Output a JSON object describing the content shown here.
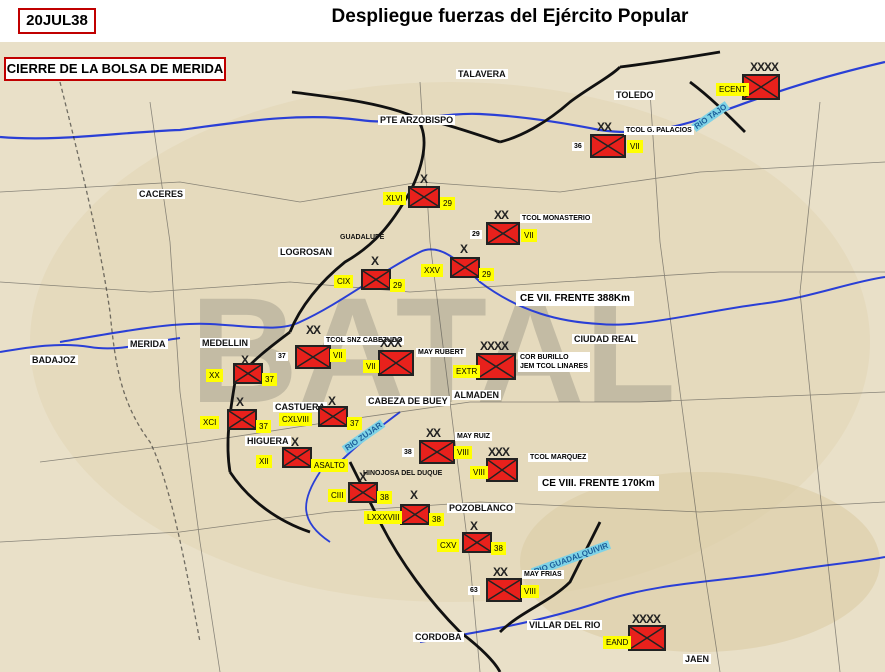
{
  "header": {
    "date": "20JUL38",
    "title": "Despliegue fuerzas del Ejército Popular"
  },
  "panel": {
    "label": "CIERRE DE LA BOLSA DE MERIDA"
  },
  "colors": {
    "unit_fill": "#e8211c",
    "label_bg": "#ffff00",
    "river": "#2a3fd6",
    "front_line": "#111111",
    "map_bg": "#e9e0c8"
  },
  "places": {
    "pte_arzobispo": "PTE ARZOBISPO",
    "toledo": "TOLEDO",
    "talavera": "TALAVERA",
    "caceres": "CACERES",
    "logrosan": "LOGROSAN",
    "guadalupe": "GUADALUPE",
    "merida": "MERIDA",
    "medellin": "MEDELLIN",
    "badajoz": "BADAJOZ",
    "castuera": "CASTUERA",
    "higuera": "HIGUERA",
    "cabeza_de_buey": "CABEZA DE BUEY",
    "almaden": "ALMADEN",
    "ciudad_real": "CIUDAD REAL",
    "pozoblanco": "POZOBLANCO",
    "hinojosa": "HINOJOSA DEL DUQUE",
    "cordoba": "CORDOBA",
    "villar_del_rio": "VILLAR DEL RIO",
    "jaen": "JAEN",
    "rio_tajo": "RIO TAJO",
    "rio_zujar": "RIO ZUJAR",
    "rio_guadalquivir": "RIO GUADALQUIVIR"
  },
  "fronts": {
    "ce_vii": "CE VII. FRENTE 388Km",
    "ce_viii": "CE VIII. FRENTE 170Km"
  },
  "units": [
    {
      "id": "ecent",
      "echelon": "XXXX",
      "labels": [
        "ECENT"
      ]
    },
    {
      "id": "vii-palacios",
      "echelon": "XX",
      "labels": [
        "36",
        "VII"
      ],
      "note": "TCOL G. PALACIOS"
    },
    {
      "id": "xlvi",
      "echelon": "X",
      "labels": [
        "XLVI",
        "29"
      ]
    },
    {
      "id": "vii-monasterio",
      "echelon": "XX",
      "labels": [
        "29",
        "VII"
      ],
      "note": "TCOL MONASTERIO"
    },
    {
      "id": "xxv",
      "echelon": "X",
      "labels": [
        "XXV",
        "29"
      ]
    },
    {
      "id": "cix",
      "echelon": "X",
      "labels": [
        "CIX",
        "29"
      ]
    },
    {
      "id": "vii-cabezudo",
      "echelon": "XX",
      "labels": [
        "37",
        "VII"
      ],
      "note": "TCOL SNZ CABEZUDO"
    },
    {
      "id": "vii-rubert",
      "echelon": "XXX",
      "labels": [
        "VII"
      ],
      "note": "MAY RUBERT"
    },
    {
      "id": "extr",
      "echelon": "XXXX",
      "labels": [
        "EXTR"
      ],
      "note": "COR BURILLO\nJEM TCOL LINARES"
    },
    {
      "id": "xx",
      "echelon": "X",
      "labels": [
        "XX",
        "37"
      ]
    },
    {
      "id": "xci",
      "echelon": "X",
      "labels": [
        "XCI",
        "37"
      ]
    },
    {
      "id": "cxlviii",
      "echelon": "X",
      "labels": [
        "CXLVIII",
        "37"
      ]
    },
    {
      "id": "viii-ruiz",
      "echelon": "XX",
      "labels": [
        "38",
        "VIII"
      ],
      "note": "MAY RUIZ"
    },
    {
      "id": "viii-marquez",
      "echelon": "XXX",
      "labels": [
        "VIII"
      ],
      "note": "TCOL MARQUEZ"
    },
    {
      "id": "xii",
      "echelon": "X",
      "labels": [
        "XII",
        "ASALTO"
      ]
    },
    {
      "id": "ciii",
      "echelon": "X",
      "labels": [
        "CIII",
        "38"
      ]
    },
    {
      "id": "lxxxviii",
      "echelon": "X",
      "labels": [
        "LXXXVIII",
        "38"
      ]
    },
    {
      "id": "cxv",
      "echelon": "X",
      "labels": [
        "CXV",
        "38"
      ]
    },
    {
      "id": "viii-frias",
      "echelon": "XX",
      "labels": [
        "63",
        "VIII"
      ],
      "note": "MAY FRIAS"
    },
    {
      "id": "eand",
      "echelon": "XXXX",
      "labels": [
        "EAND"
      ]
    }
  ]
}
